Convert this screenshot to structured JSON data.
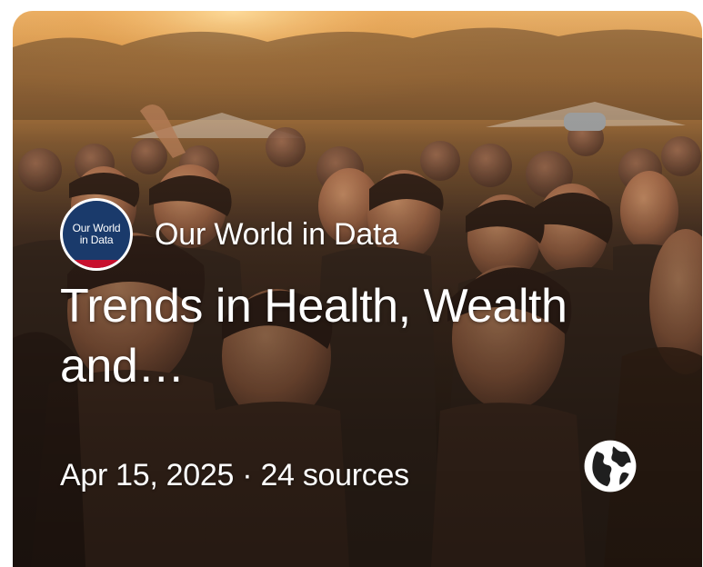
{
  "card": {
    "source": {
      "name": "Our World in Data",
      "logo_line1": "Our World",
      "logo_line2": "in Data"
    },
    "title": "Trends in Health, Wealth and…",
    "date": "Apr 15, 2025",
    "separator": "·",
    "sources_count": "24 sources",
    "visibility_icon": "globe-icon",
    "image": "festival-crowd-photo"
  },
  "colors": {
    "logo_background": "#1a3a6b",
    "logo_stripe": "#c8102e",
    "text": "#ffffff"
  }
}
